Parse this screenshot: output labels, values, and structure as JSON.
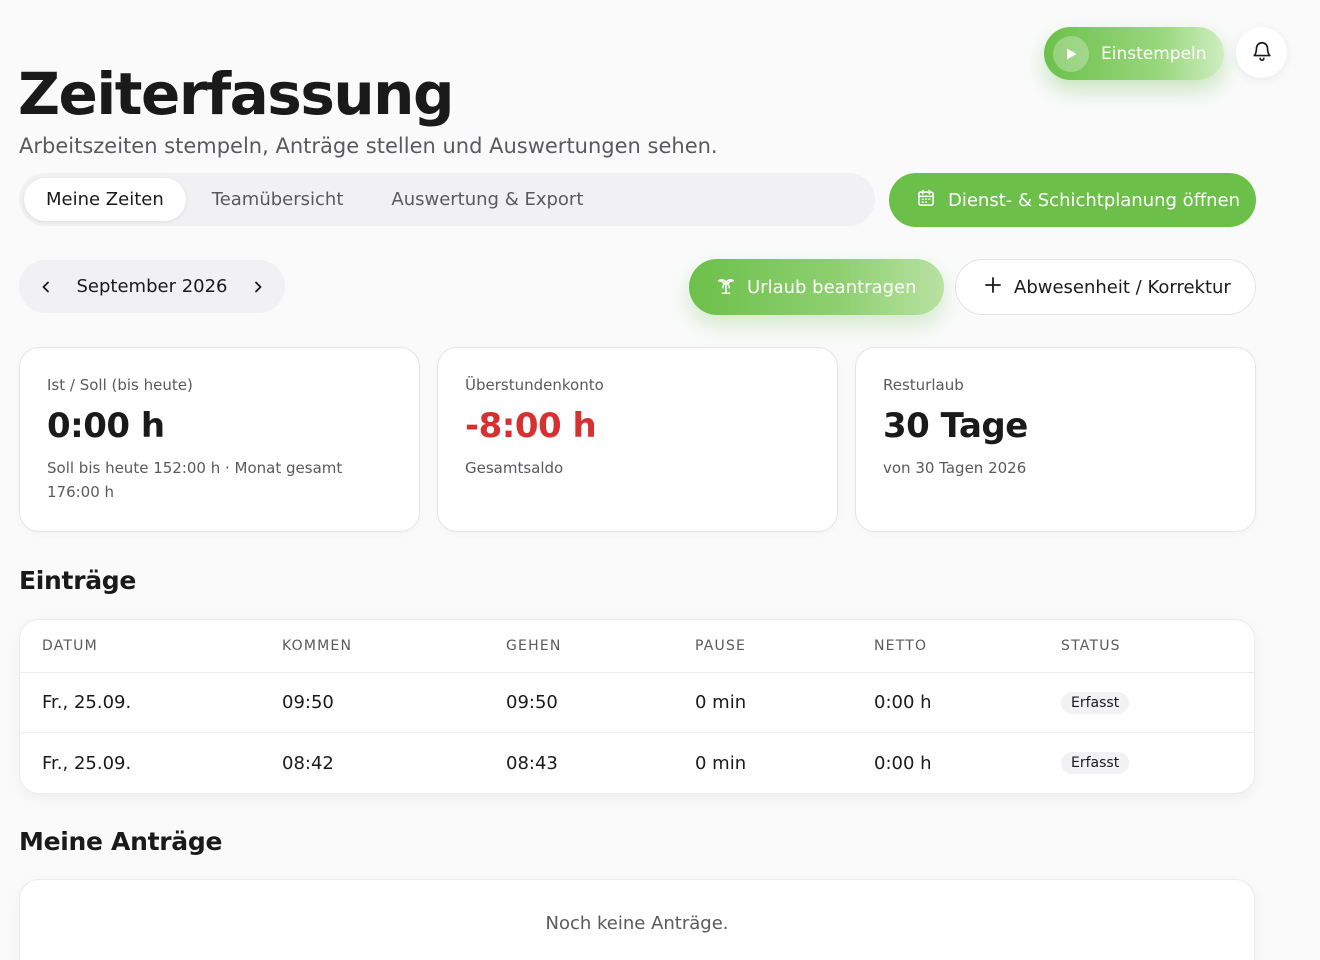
{
  "header": {
    "title": "Zeiterfassung",
    "subtitle": "Arbeitszeiten stempeln, Anträge stellen und Auswertungen sehen."
  },
  "topbar": {
    "clock_in_label": "Einstempeln",
    "clock_in_icon": "play-icon",
    "notifications_icon": "bell-icon"
  },
  "tabs": [
    {
      "label": "Meine Zeiten",
      "active": true
    },
    {
      "label": "Teamübersicht",
      "active": false
    },
    {
      "label": "Auswertung & Export",
      "active": false
    }
  ],
  "planning_button": {
    "label": "Dienst- & Schichtplanung öffnen",
    "icon": "calendar-icon"
  },
  "month_switcher": {
    "label": "September 2026",
    "prev_icon": "chevron-left-icon",
    "next_icon": "chevron-right-icon"
  },
  "actions": {
    "vacation_label": "Urlaub beantragen",
    "vacation_icon": "palm-tree-icon",
    "absence_label": "Abwesenheit / Korrektur",
    "absence_icon": "plus-icon"
  },
  "stats": [
    {
      "label": "Ist / Soll (bis heute)",
      "value": "0:00 h",
      "note": "Soll bis heute 152:00 h · Monat gesamt 176:00 h"
    },
    {
      "label": "Überstundenkonto",
      "value": "-8:00 h",
      "note": "Gesamtsaldo",
      "negative": true
    },
    {
      "label": "Resturlaub",
      "value": "30 Tage",
      "note": "von 30 Tagen 2026"
    }
  ],
  "entries": {
    "title": "Einträge",
    "columns": [
      "DATUM",
      "KOMMEN",
      "GEHEN",
      "PAUSE",
      "NETTO",
      "STATUS"
    ],
    "rows": [
      {
        "date": "Fr., 25.09.",
        "in": "09:50",
        "out": "09:50",
        "pause": "0 min",
        "net": "0:00 h",
        "status": "Erfasst"
      },
      {
        "date": "Fr., 25.09.",
        "in": "08:42",
        "out": "08:43",
        "pause": "0 min",
        "net": "0:00 h",
        "status": "Erfasst"
      }
    ]
  },
  "requests": {
    "title": "Meine Anträge",
    "empty_text": "Noch keine Anträge."
  },
  "colors": {
    "accent_green": "#6cc04a",
    "negative_red": "#d63031",
    "text_muted": "#5a5a5e"
  }
}
